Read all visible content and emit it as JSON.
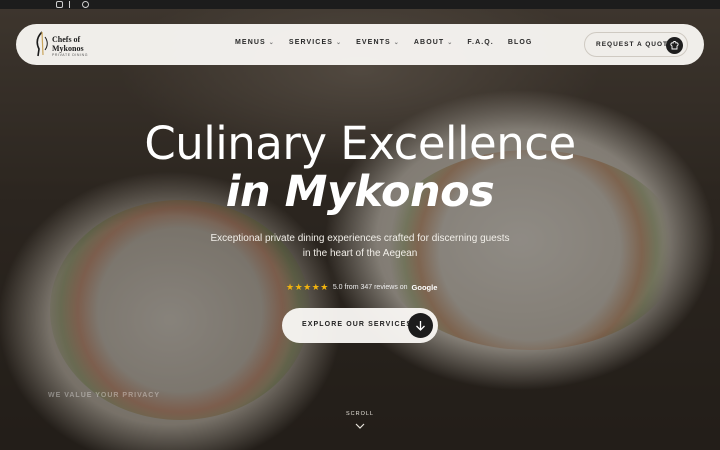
{
  "header": {
    "logo": {
      "line1": "Chefs of",
      "line2": "Mykonos",
      "tagline": "PRIVATE DINING"
    },
    "nav": [
      {
        "label": "MENUS",
        "dropdown": true
      },
      {
        "label": "SERVICES",
        "dropdown": true
      },
      {
        "label": "EVENTS",
        "dropdown": true
      },
      {
        "label": "ABOUT",
        "dropdown": true
      },
      {
        "label": "F.A.Q.",
        "dropdown": false
      },
      {
        "label": "BLOG",
        "dropdown": false
      }
    ],
    "quote_button": "REQUEST A QUOTE"
  },
  "hero": {
    "title_line1": "Culinary Excellence",
    "title_line2": "in Mykonos",
    "subtitle": "Exceptional private dining experiences crafted for discerning guests in the heart of the Aegean",
    "rating": {
      "stars": "★★★★★",
      "text": "5.0 from 347 reviews on",
      "source": "Google"
    },
    "cta": "EXPLORE OUR SERVICES",
    "scroll": "SCROLL"
  },
  "cookie": {
    "title": "WE VALUE YOUR PRIVACY"
  },
  "icons": {
    "social": [
      "instagram-icon",
      "tiktok-icon",
      "whatsapp-icon"
    ],
    "quote": "chef-hat-icon",
    "cta": "arrow-down-icon",
    "scroll": "chevron-down-icon"
  },
  "colors": {
    "accent": "#1c1c1c",
    "star": "#f2b40e",
    "header_bg": "#f8f6f2"
  }
}
